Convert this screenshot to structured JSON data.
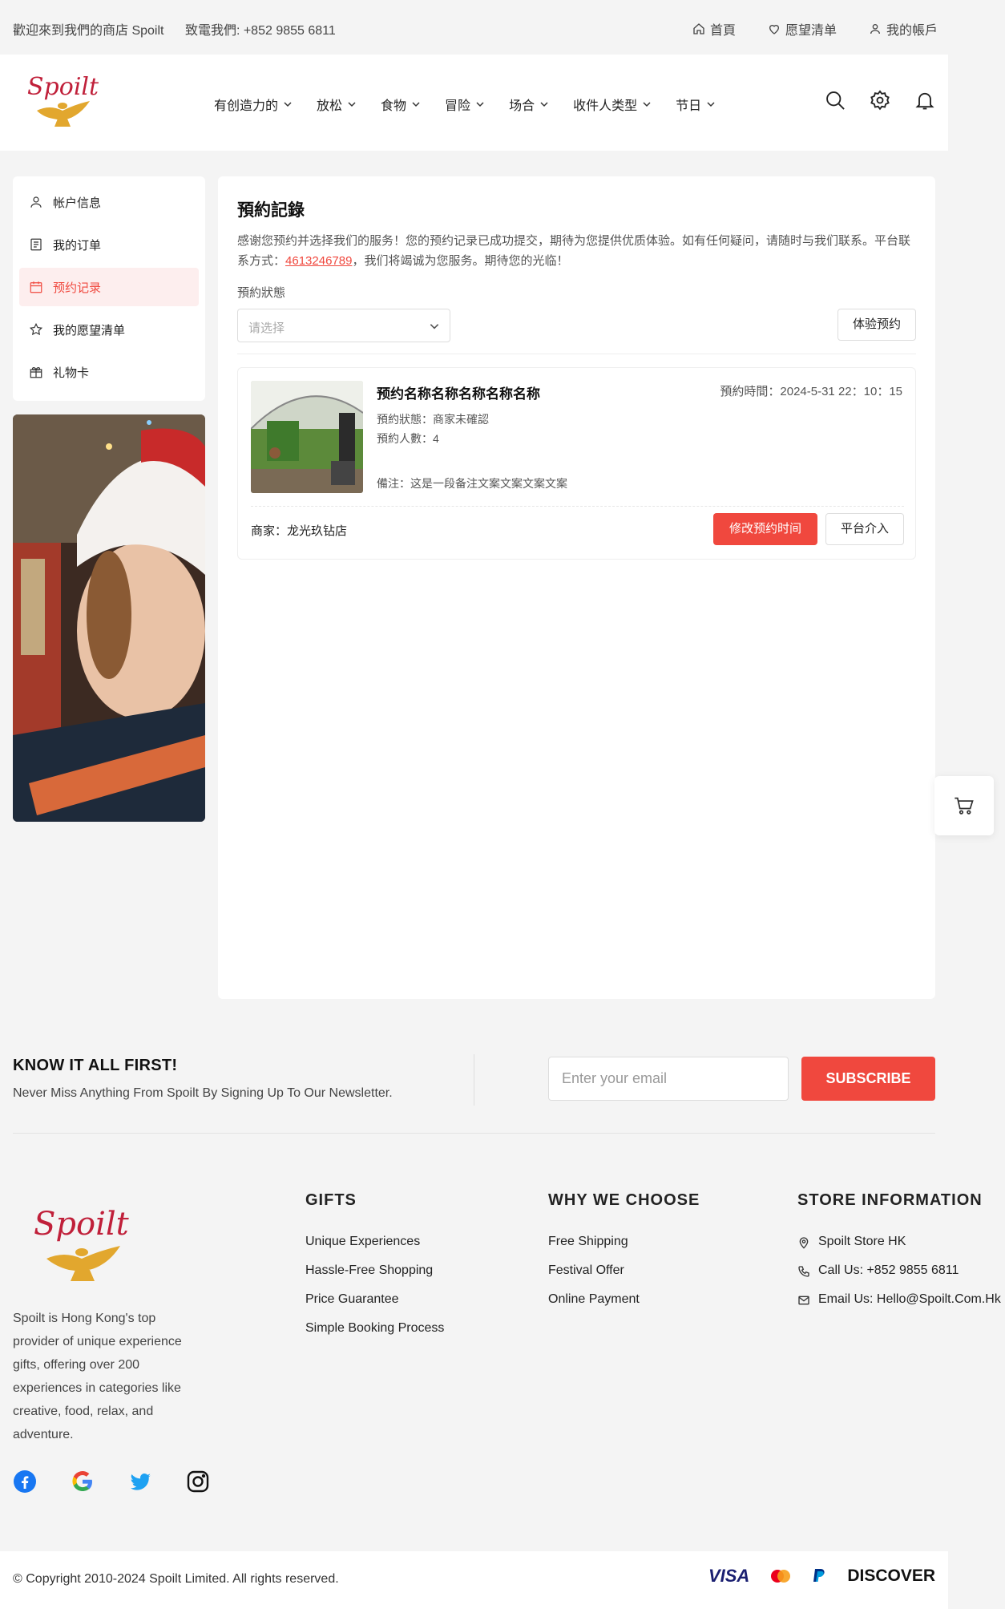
{
  "topbar": {
    "welcome": "歡迎來到我們的商店 Spoilt",
    "phone": "致電我們: +852 9855 6811",
    "home": "首頁",
    "wishlist": "愿望清单",
    "account": "我的帳戶"
  },
  "header": {
    "logo_text": "Spoilt",
    "nav": [
      "有创造力的",
      "放松",
      "食物",
      "冒险",
      "场合",
      "收件人类型",
      "节日"
    ]
  },
  "sidebar": {
    "items": [
      {
        "label": "帐户信息",
        "icon": "user-icon",
        "active": false
      },
      {
        "label": "我的订单",
        "icon": "orders-icon",
        "active": false
      },
      {
        "label": "预约记录",
        "icon": "calendar-icon",
        "active": true
      },
      {
        "label": "我的愿望清单",
        "icon": "star-icon",
        "active": false
      },
      {
        "label": "礼物卡",
        "icon": "gift-icon",
        "active": false
      }
    ]
  },
  "main": {
    "title": "預約記錄",
    "desc_before": "感谢您预约并选择我们的服务！您的预约记录已成功提交，期待为您提供优质体验。如有任何疑问，请随时与我们联系。平台联系方式：",
    "contact": "4613246789",
    "desc_after": "，我们将竭诚为您服务。期待您的光临！",
    "status_label": "預約狀態",
    "select_placeholder": "请选择",
    "experience_button": "体验预约",
    "booking": {
      "name": "预约名称名称名称名称名称",
      "time": "預約時間：2024-5-31 22：10：15",
      "status": "預約狀態：商家未確認",
      "people": "預約人數：4",
      "note": "備注：这是一段备注文案文案文案文案",
      "merchant": "商家：龙光玖钻店",
      "modify_button": "修改预约时间",
      "platform_button": "平台介入"
    }
  },
  "newsletter": {
    "title": "KNOW IT ALL FIRST!",
    "subtitle": "Never Miss Anything From Spoilt By Signing Up To Our Newsletter.",
    "placeholder": "Enter your email",
    "button": "SUBSCRIBE"
  },
  "footer": {
    "about": "Spoilt is Hong Kong's top provider of unique experience gifts, offering over 200 experiences in categories like creative, food, relax, and adventure.",
    "gifts": {
      "title": "GIFTS",
      "items": [
        "Unique Experiences",
        "Hassle-Free Shopping",
        "Price Guarantee",
        "Simple Booking Process"
      ]
    },
    "why": {
      "title": "WHY WE CHOOSE",
      "items": [
        "Free Shipping",
        "Festival Offer",
        "Online Payment"
      ]
    },
    "store": {
      "title": "STORE INFORMATION",
      "items": [
        "Spoilt Store HK",
        "Call Us: +852 9855 6811",
        "Email Us: Hello@Spoilt.Com.Hk"
      ]
    },
    "copyright": "© Copyright 2010-2024 Spoilt Limited. All rights reserved.",
    "payments": {
      "visa": "VISA",
      "discover": "DISCOVER"
    }
  },
  "colors": {
    "accent": "#f0483e",
    "logo_red": "#c0203a",
    "logo_gold": "#e2a72e"
  }
}
